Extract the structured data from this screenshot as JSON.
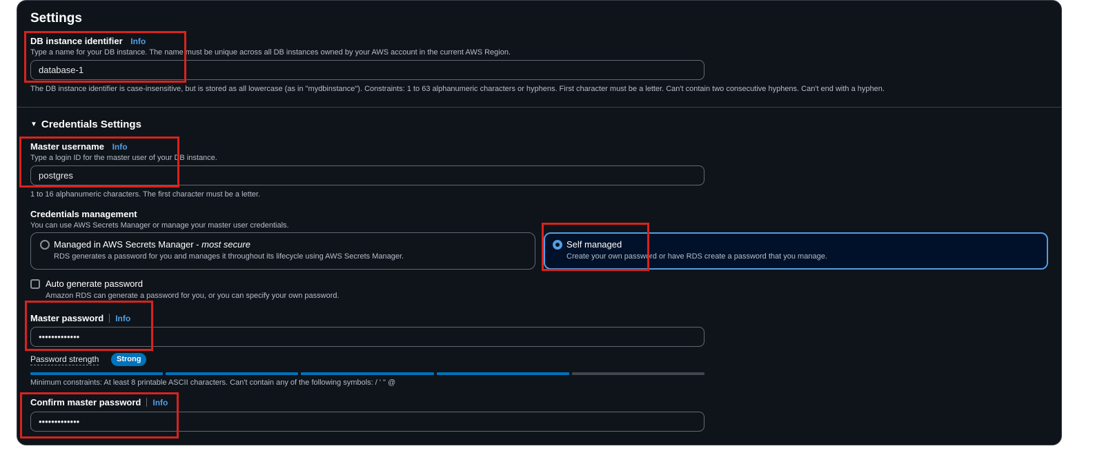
{
  "settings": {
    "title": "Settings",
    "db_identifier": {
      "label": "DB instance identifier",
      "info": "Info",
      "description": "Type a name for your DB instance. The name must be unique across all DB instances owned by your AWS account in the current AWS Region.",
      "value": "database-1",
      "constraint": "The DB instance identifier is case-insensitive, but is stored as all lowercase (as in \"mydbinstance\"). Constraints: 1 to 63 alphanumeric characters or hyphens. First character must be a letter. Can't contain two consecutive hyphens. Can't end with a hyphen."
    }
  },
  "credentials": {
    "section_title": "Credentials Settings",
    "master_username": {
      "label": "Master username",
      "info": "Info",
      "description": "Type a login ID for the master user of your DB instance.",
      "value": "postgres",
      "constraint": "1 to 16 alphanumeric characters. The first character must be a letter."
    },
    "management": {
      "label": "Credentials management",
      "description": "You can use AWS Secrets Manager or manage your master user credentials.",
      "options": [
        {
          "title": "Managed in AWS Secrets Manager - ",
          "title_emphasis": "most secure",
          "description": "RDS generates a password for you and manages it throughout its lifecycle using AWS Secrets Manager.",
          "selected": false
        },
        {
          "title": "Self managed",
          "description": "Create your own password or have RDS create a password that you manage.",
          "selected": true
        }
      ]
    },
    "auto_generate": {
      "label": "Auto generate password",
      "description": "Amazon RDS can generate a password for you, or you can specify your own password.",
      "checked": false
    },
    "master_password": {
      "label": "Master password",
      "info": "Info",
      "value": "•••••••••••••"
    },
    "password_strength": {
      "label": "Password strength",
      "badge": "Strong",
      "level": 0.8,
      "segments_filled": 4,
      "segments_total": 5,
      "constraint": "Minimum constraints: At least 8 printable ASCII characters. Can't contain any of the following symbols: / ' \" @"
    },
    "confirm_password": {
      "label": "Confirm master password",
      "info": "Info",
      "value": "•••••••••••••"
    }
  },
  "colors": {
    "background": "#0f141a",
    "accent": "#539fe5",
    "meter_fill": "#0073bb",
    "meter_empty": "#414750",
    "highlight_box": "#d9231d"
  }
}
